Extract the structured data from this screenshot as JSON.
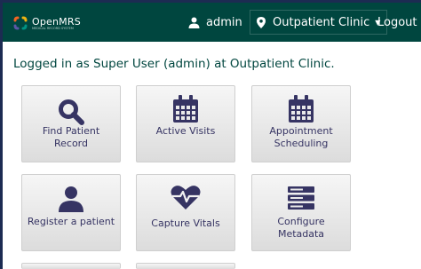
{
  "header": {
    "brand": "OpenMRS",
    "brand_sub": "MEDICAL RECORD SYSTEM",
    "user": "admin",
    "location": "Outpatient Clinic",
    "logout": "Logout"
  },
  "welcome": "Logged in as Super User (admin) at Outpatient Clinic.",
  "apps": [
    {
      "label": "Find Patient Record",
      "icon": "search-icon"
    },
    {
      "label": "Active Visits",
      "icon": "calendar-icon"
    },
    {
      "label": "Appointment Scheduling",
      "icon": "calendar-icon"
    },
    {
      "label": "Register a patient",
      "icon": "user-icon"
    },
    {
      "label": "Capture Vitals",
      "icon": "heartbeat-icon"
    },
    {
      "label": "Configure Metadata",
      "icon": "server-icon"
    }
  ],
  "colors": {
    "header_bg": "#00463f",
    "accent_text": "#00463f",
    "tile_text": "#363463"
  }
}
